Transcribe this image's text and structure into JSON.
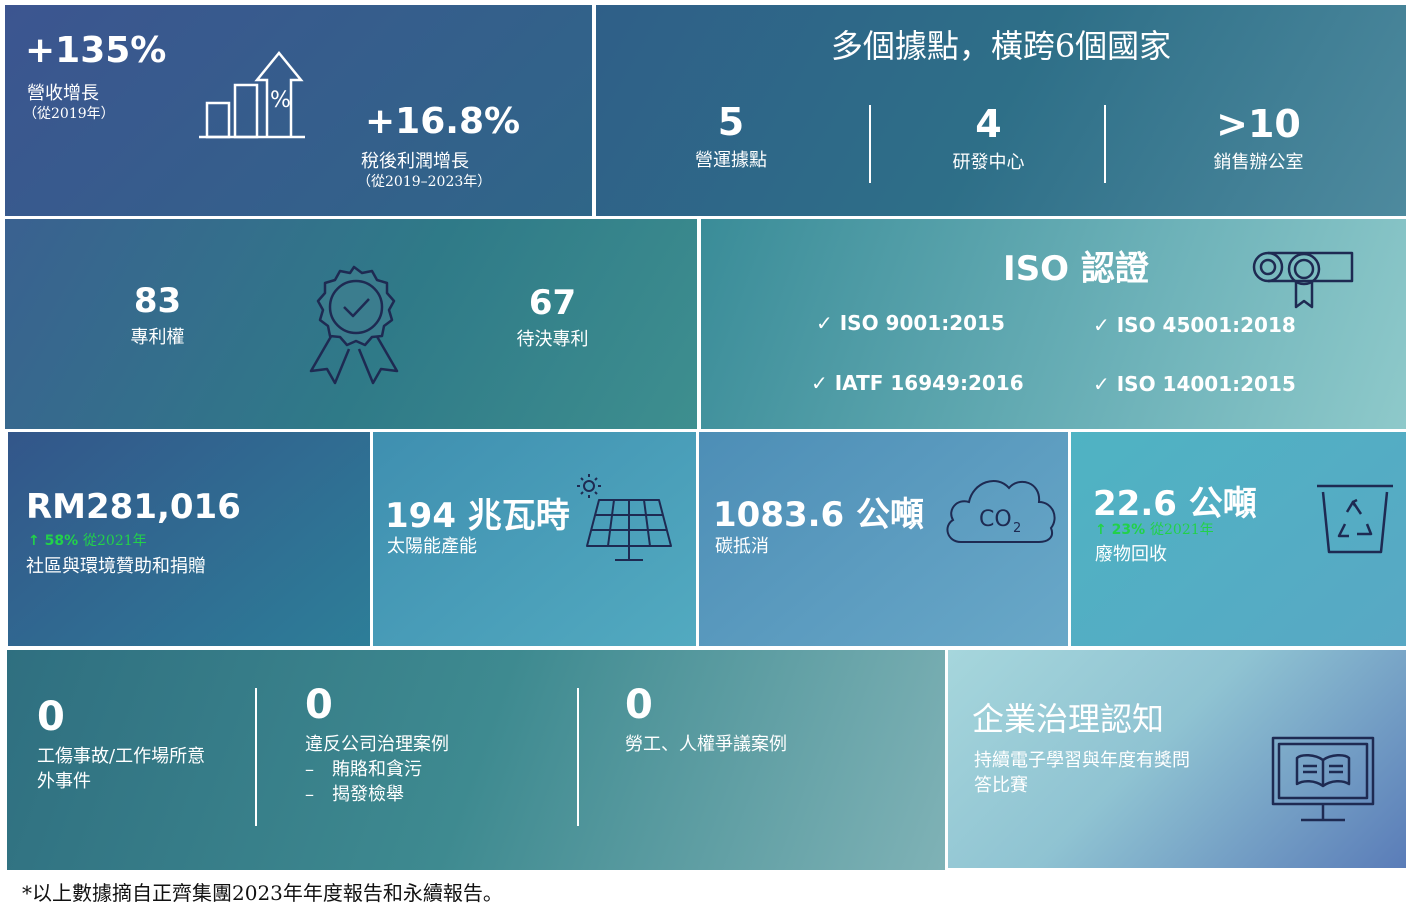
{
  "revenue": {
    "value": "+135%",
    "label": "營收增長",
    "sub": "（從2019年）",
    "icon": "growth-chart-percent-icon"
  },
  "profit": {
    "value": "+16.8%",
    "label": "稅後利潤增長",
    "sub": "（從2019–2023年）"
  },
  "locations": {
    "title": "多個據點，橫跨6個國家",
    "stats": [
      {
        "value": "5",
        "label": "營運據點"
      },
      {
        "value": "4",
        "label": "研發中心"
      },
      {
        "value": ">10",
        "label": "銷售辦公室"
      }
    ]
  },
  "patents": {
    "granted_value": "83",
    "granted_label": "專利權",
    "pending_value": "67",
    "pending_label": "待決專利",
    "icon": "award-ribbon-icon"
  },
  "iso": {
    "title": "ISO 認證",
    "icon": "certificate-scroll-icon",
    "items": [
      "ISO 9001:2015",
      "ISO 45001:2018",
      "IATF 16949:2016",
      "ISO 14001:2015"
    ]
  },
  "community": {
    "value": "RM281,016",
    "change": "58%",
    "change_since": "從2021年",
    "label": "社區與環境贊助和捐贈"
  },
  "solar": {
    "value": "194 兆瓦時",
    "label": "太陽能產能",
    "icon": "solar-panel-icon"
  },
  "carbon": {
    "value": "1083.6 公噸",
    "label": "碳抵消",
    "icon_text": "CO",
    "icon_sub": "2",
    "icon": "co2-cloud-icon"
  },
  "waste": {
    "value": "22.6 公噸",
    "change": "23%",
    "change_since": "從2021年",
    "label": "廢物回收",
    "icon": "recycle-bin-icon"
  },
  "safety": {
    "items": [
      {
        "value": "0",
        "label_lines": [
          "工傷事故/工作場所意",
          "外事件"
        ]
      },
      {
        "value": "0",
        "label_lines": [
          "違反公司治理案例",
          "–　賄賂和貪污",
          "–　揭發檢舉"
        ]
      },
      {
        "value": "0",
        "label_lines": [
          "勞工、人權爭議案例"
        ]
      }
    ]
  },
  "governance": {
    "title": "企業治理認知",
    "lines": [
      "持續電子學習與年度有獎問",
      "答比賽"
    ],
    "icon": "monitor-book-icon"
  },
  "footnote": "*以上數據摘自正齊集團2023年年度報告和永續報告。",
  "colors": {
    "accent_green": "#22d14a",
    "text": "#ffffff"
  }
}
